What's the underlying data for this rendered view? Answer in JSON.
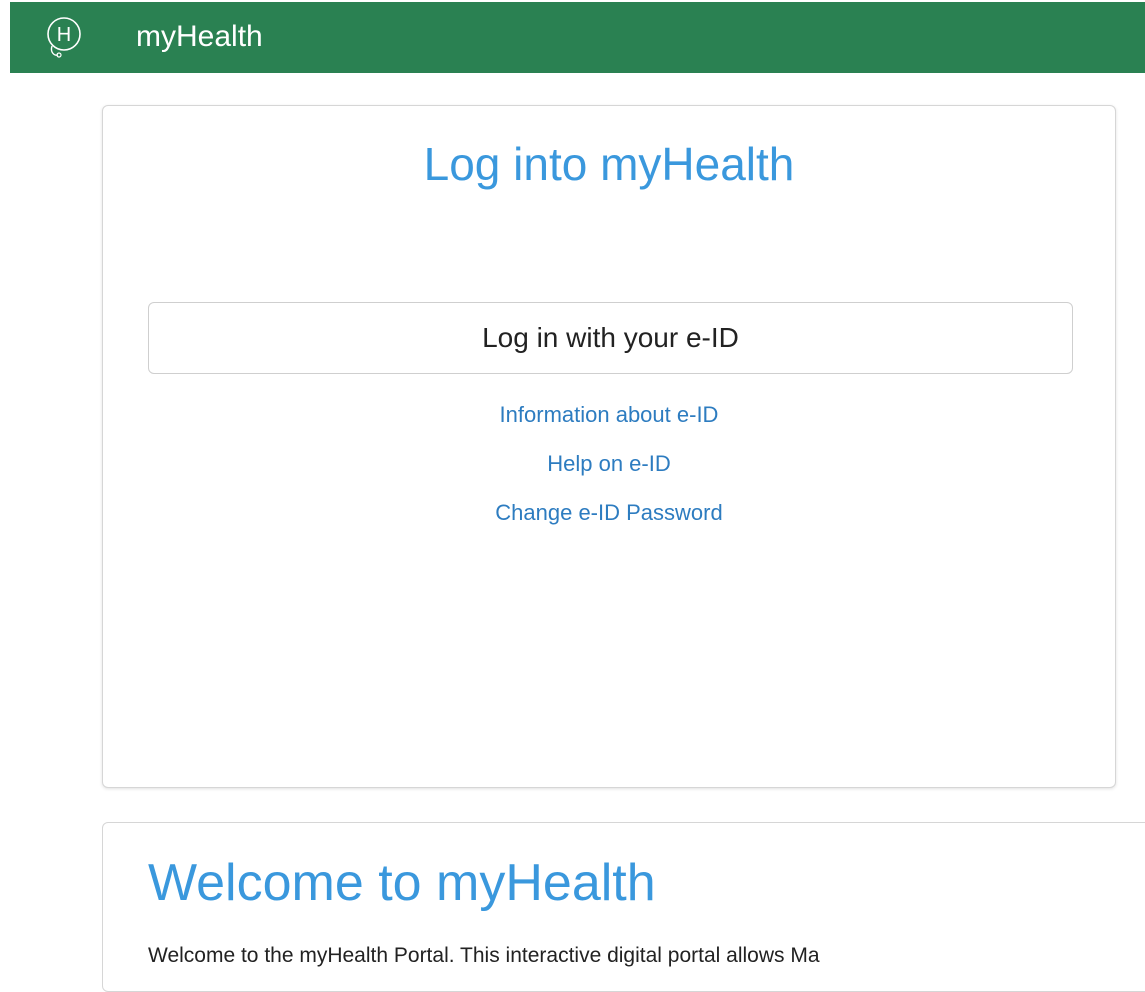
{
  "header": {
    "brand": "myHealth",
    "logo_letter": "H",
    "logo_icon": "stethoscope-h-logo",
    "background_color": "#2a8152"
  },
  "login": {
    "title": "Log into myHealth",
    "button_label": "Log in with your e-ID",
    "links": [
      {
        "label": "Information about e-ID"
      },
      {
        "label": "Help on e-ID"
      },
      {
        "label": "Change e-ID Password"
      }
    ]
  },
  "welcome": {
    "title": "Welcome to myHealth",
    "text": "Welcome to the myHealth Portal. This interactive digital portal allows Ma"
  },
  "colors": {
    "title_blue": "#3a98dd",
    "link_blue": "#2d7cc0"
  }
}
